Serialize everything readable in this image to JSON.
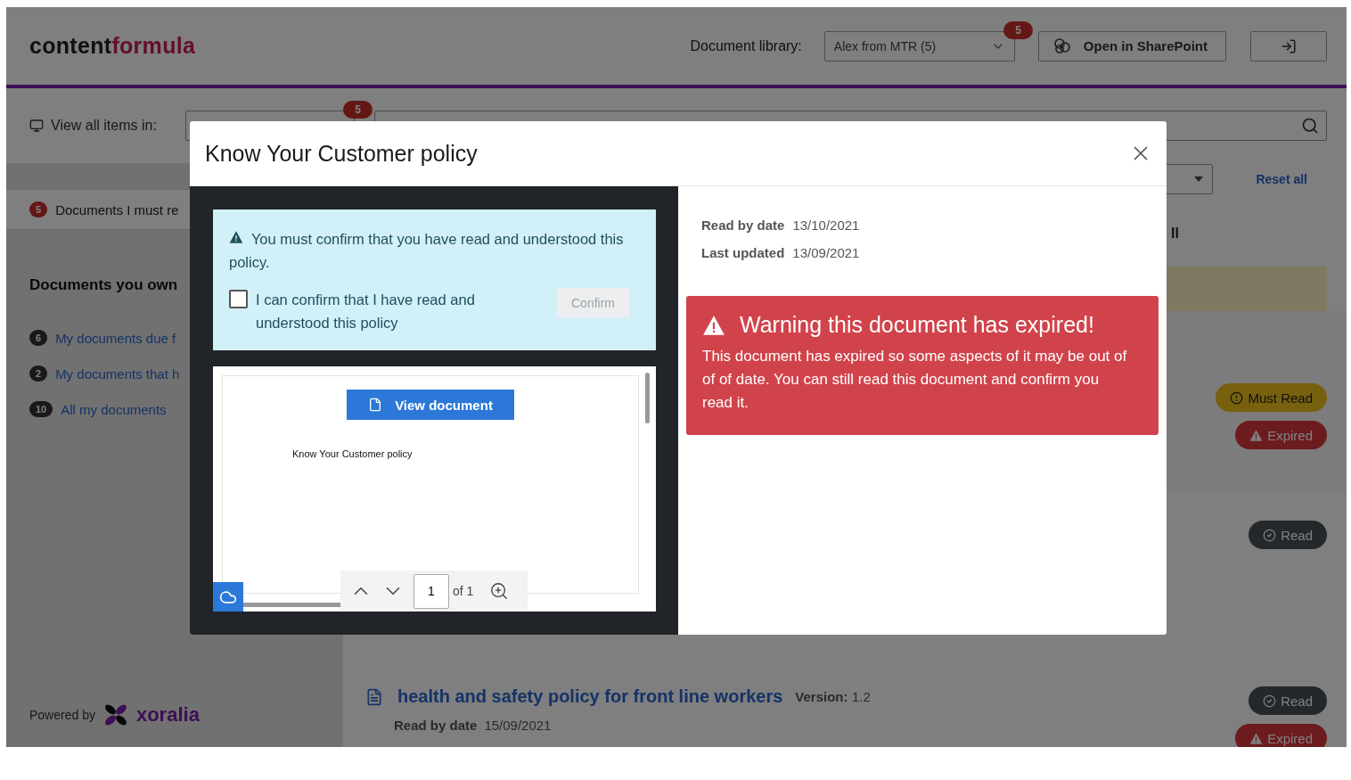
{
  "header": {
    "logo_part_1": "content",
    "logo_part_2": "formula",
    "library_label": "Document library:",
    "library_select": "Alex from MTR (5)",
    "library_badge": "5",
    "sharepoint_button": "Open in SharePoint"
  },
  "topbar": {
    "view_all_label": "View all items in:",
    "view_all_badge": "5"
  },
  "sidebar": {
    "must_read": {
      "count": "5",
      "label": "Documents I must re",
      "selected": true
    },
    "own_heading": "Documents you own",
    "own_items": [
      {
        "count": "6",
        "label": "My documents due f"
      },
      {
        "count": "2",
        "label": "My documents that h"
      },
      {
        "count": "10",
        "label": "All my documents"
      }
    ],
    "powered_by": "Powered by",
    "brand": "xoralia"
  },
  "main": {
    "reset_link": "Reset all",
    "filter_partial": "ll",
    "documents": [
      {
        "badges": [
          {
            "kind": "must_read",
            "label": "Must Read"
          },
          {
            "kind": "expired",
            "label": "Expired"
          }
        ]
      },
      {
        "badges": [
          {
            "kind": "read",
            "label": "Read"
          }
        ]
      },
      {
        "title": "health and safety policy for front line workers",
        "version_label": "Version:",
        "version": "1.2",
        "read_by_label": "Read by date",
        "read_by": "15/09/2021",
        "badges": [
          {
            "kind": "read",
            "label": "Read"
          },
          {
            "kind": "expired",
            "label": "Expired"
          }
        ]
      }
    ]
  },
  "modal": {
    "title": "Know Your Customer policy",
    "notice": {
      "text": "You must confirm that you have read and understood this policy.",
      "checkbox_label": "I can confirm that I have read and understood this policy",
      "checked": false,
      "confirm_button": "Confirm",
      "confirm_disabled": true
    },
    "viewer": {
      "button": "View document",
      "page_text": "Know Your Customer policy",
      "page_input": "1",
      "page_count": "of 1"
    },
    "details": [
      {
        "label": "Read by date",
        "value": "13/10/2021"
      },
      {
        "label": "Last updated",
        "value": "13/09/2021"
      }
    ],
    "alert": {
      "heading": "Warning this document has expired!",
      "text": "This document has expired so some aspects of it may be out of of of date. You can still read this document and confirm you read it."
    }
  }
}
